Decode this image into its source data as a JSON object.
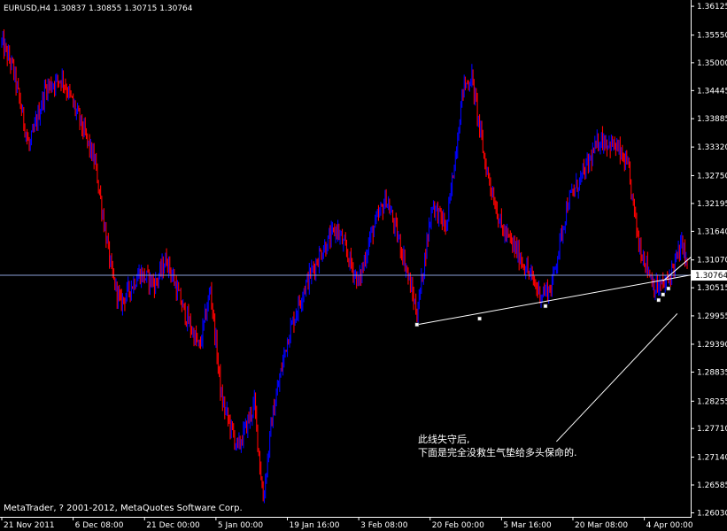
{
  "header": {
    "symbol": "EURUSD,H4",
    "open": "1.30837",
    "high": "1.30855",
    "low": "1.30715",
    "close": "1.30764"
  },
  "copyright": "MetaTrader, ? 2001-2012, MetaQuotes Software Corp.",
  "annotation": {
    "line1": "此线失守后,",
    "line2": "下面是完全没救生气垫给多头保命的."
  },
  "colors": {
    "background": "#000000",
    "bull": "#0000ff",
    "bear": "#ff0000",
    "axis": "#ffffff",
    "trendline": "#ffffff",
    "priceline": "#8c9fd8"
  },
  "chart_data": {
    "type": "candlestick",
    "symbol": "EURUSD",
    "timeframe": "H4",
    "current_price": 1.30764,
    "y_ticks": [
      "1.36125",
      "1.35550",
      "1.35000",
      "1.34445",
      "1.33885",
      "1.33320",
      "1.32750",
      "1.32195",
      "1.31640",
      "1.31070",
      "1.30515",
      "1.29955",
      "1.29390",
      "1.28835",
      "1.28255",
      "1.27710",
      "1.27140",
      "1.26585",
      "1.26030"
    ],
    "ylim": [
      1.2595,
      1.3625
    ],
    "x_ticks": [
      "21 Nov 2011",
      "6 Dec 08:00",
      "21 Dec 00:00",
      "5 Jan 00:00",
      "19 Jan 16:00",
      "3 Feb 08:00",
      "20 Feb 00:00",
      "5 Mar 16:00",
      "20 Mar 08:00",
      "4 Apr 00:00"
    ],
    "x_tick_index": [
      0,
      65,
      130,
      195,
      260,
      325,
      390,
      455,
      520,
      585
    ],
    "bar_count": 625,
    "series_path": [
      [
        0,
        1.354
      ],
      [
        10,
        1.349
      ],
      [
        25,
        1.333
      ],
      [
        40,
        1.345
      ],
      [
        55,
        1.347
      ],
      [
        70,
        1.339
      ],
      [
        85,
        1.33
      ],
      [
        100,
        1.308
      ],
      [
        108,
        1.302
      ],
      [
        125,
        1.308
      ],
      [
        140,
        1.306
      ],
      [
        150,
        1.311
      ],
      [
        165,
        1.301
      ],
      [
        180,
        1.293
      ],
      [
        190,
        1.305
      ],
      [
        200,
        1.283
      ],
      [
        215,
        1.273
      ],
      [
        230,
        1.282
      ],
      [
        238,
        1.263
      ],
      [
        246,
        1.279
      ],
      [
        260,
        1.295
      ],
      [
        275,
        1.305
      ],
      [
        290,
        1.312
      ],
      [
        305,
        1.317
      ],
      [
        325,
        1.306
      ],
      [
        335,
        1.315
      ],
      [
        350,
        1.323
      ],
      [
        365,
        1.312
      ],
      [
        378,
        1.3
      ],
      [
        392,
        1.322
      ],
      [
        405,
        1.317
      ],
      [
        420,
        1.345
      ],
      [
        428,
        1.347
      ],
      [
        440,
        1.33
      ],
      [
        455,
        1.317
      ],
      [
        470,
        1.312
      ],
      [
        490,
        1.304
      ],
      [
        500,
        1.305
      ],
      [
        515,
        1.322
      ],
      [
        530,
        1.328
      ],
      [
        545,
        1.335
      ],
      [
        560,
        1.333
      ],
      [
        570,
        1.329
      ],
      [
        580,
        1.314
      ],
      [
        595,
        1.305
      ],
      [
        605,
        1.306
      ],
      [
        620,
        1.314
      ],
      [
        625,
        1.3076
      ]
    ],
    "trendlines": [
      {
        "name": "support",
        "from": {
          "x": 378,
          "y": 1.2978
        },
        "to": {
          "x": 625,
          "y": 1.3076
        },
        "extended_right": true
      },
      {
        "name": "rising",
        "from": {
          "x": 602,
          "y": 1.3065
        },
        "to": {
          "x": 625,
          "y": 1.3108
        },
        "extended_right": true
      },
      {
        "name": "pointer",
        "from": {
          "x": 505,
          "y": 1.2745
        },
        "to": {
          "x": 615,
          "y": 1.3
        }
      }
    ],
    "markers": [
      {
        "x": 378,
        "y": 1.2978
      },
      {
        "x": 435,
        "y": 1.299
      },
      {
        "x": 495,
        "y": 1.3015
      },
      {
        "x": 598,
        "y": 1.3027
      },
      {
        "x": 602,
        "y": 1.3038
      },
      {
        "x": 607,
        "y": 1.305
      }
    ]
  }
}
